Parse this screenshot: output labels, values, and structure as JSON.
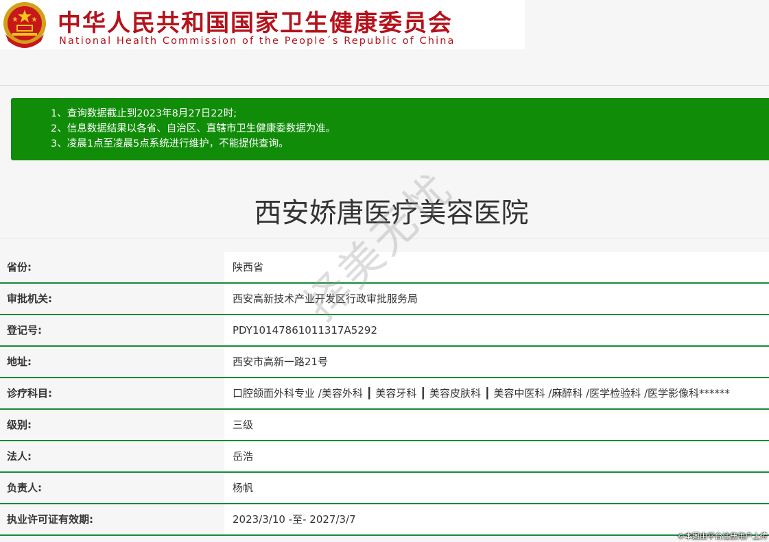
{
  "header": {
    "title_cn": "中华人民共和国国家卫生健康委员会",
    "title_en": "National Health Commission of the People´s Republic of China",
    "emblem_icon": "national-emblem-icon"
  },
  "notice": {
    "lines": [
      "1、查询数据截止到2023年8月27日22时;",
      "2、信息数据结果以各省、自治区、直辖市卫生健康委数据为准。",
      "3、凌晨1点至凌晨5点系统进行维护，不能提供查询。"
    ],
    "background_color": "#108c08"
  },
  "hospital_name": "西安娇唐医疗美容医院",
  "info": {
    "rows": [
      {
        "label": "省份:",
        "value": "陕西省"
      },
      {
        "label": "审批机关:",
        "value": "西安高新技术产业开发区行政审批服务局"
      },
      {
        "label": "登记号:",
        "value": "PDY10147861011317A5292"
      },
      {
        "label": "地址:",
        "value": "西安市高新一路21号"
      },
      {
        "label": "诊疗科目:",
        "value": "口腔颌面外科专业 /美容外科 ┃ 美容牙科 ┃ 美容皮肤科 ┃ 美容中医科 /麻醉科 /医学检验科 /医学影像科******"
      },
      {
        "label": "级别:",
        "value": "三级"
      },
      {
        "label": "法人:",
        "value": "岳浩"
      },
      {
        "label": "负责人:",
        "value": "杨帆"
      },
      {
        "label": "执业许可证有效期:",
        "value": "2023/3/10 -至- 2027/3/7"
      }
    ],
    "border_color": "#138a36"
  },
  "watermark": "择美无忧",
  "credit": "©本图由平台注册用户上传"
}
